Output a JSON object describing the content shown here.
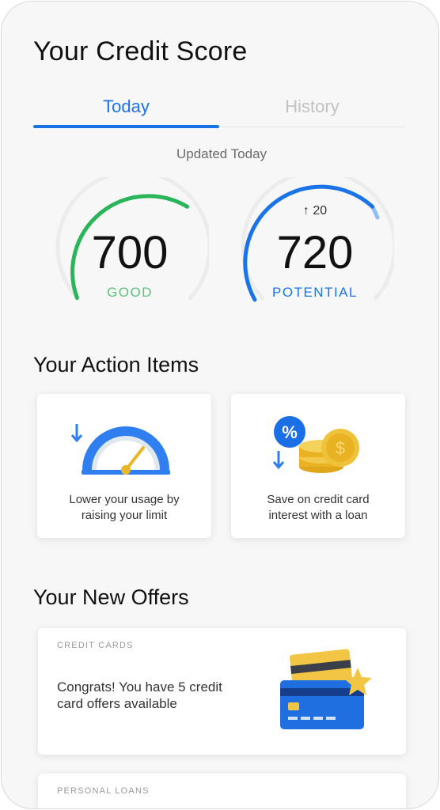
{
  "header": {
    "title": "Your Credit Score"
  },
  "tabs": [
    {
      "label": "Today",
      "active": true
    },
    {
      "label": "History",
      "active": false
    }
  ],
  "updated": "Updated Today",
  "scores": {
    "current": {
      "value": "700",
      "label": "GOOD",
      "color": "#2bb55a"
    },
    "potential": {
      "value": "720",
      "label": "POTENTIAL",
      "delta": "20",
      "color": "#1a73e8"
    }
  },
  "action_items": {
    "title": "Your Action Items",
    "items": [
      {
        "text_line1": "Lower your usage by",
        "text_line2": "raising your limit",
        "icon": "speedometer-icon"
      },
      {
        "text_line1": "Save on credit card",
        "text_line2": "interest with a loan",
        "icon": "percent-coins-icon"
      }
    ]
  },
  "offers": {
    "title": "Your New Offers",
    "items": [
      {
        "category": "CREDIT CARDS",
        "text_line1": "Congrats! You have 5 credit",
        "text_line2": "card offers available",
        "icon": "credit-cards-icon"
      },
      {
        "category": "PERSONAL LOANS"
      }
    ]
  }
}
